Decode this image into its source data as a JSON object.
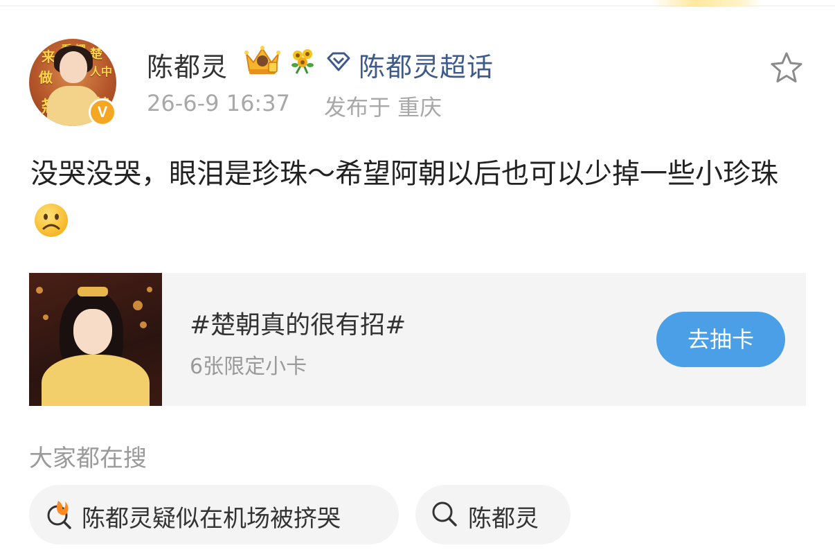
{
  "post": {
    "author": {
      "name": "陈都灵",
      "verified_badge": "V",
      "avatar_sign_text": [
        "来",
        "看",
        "翘",
        "楚",
        "做",
        "人",
        "中",
        "翘",
        "楚"
      ]
    },
    "supertopic_label": "陈都灵超话",
    "timestamp": "26-6-9 16:37",
    "location": "发布于 重庆",
    "text": "没哭没哭，眼泪是珍珠～希望阿朝以后也可以少掉一些小珍珠",
    "emoji": "frowning-face"
  },
  "card": {
    "title": "#楚朝真的很有招#",
    "subtitle": "6张限定小卡",
    "button_label": "去抽卡"
  },
  "search": {
    "section_title": "大家都在搜",
    "chips": [
      {
        "text": "陈都灵疑似在机场被挤哭",
        "icon": "hot-search-icon"
      },
      {
        "text": "陈都灵",
        "icon": "search-icon"
      }
    ]
  },
  "colors": {
    "link_blue": "#3d5a8a",
    "button_blue": "#4a9fe6",
    "gray_text": "#a8a8a8",
    "verified_orange": "#f5a623"
  }
}
